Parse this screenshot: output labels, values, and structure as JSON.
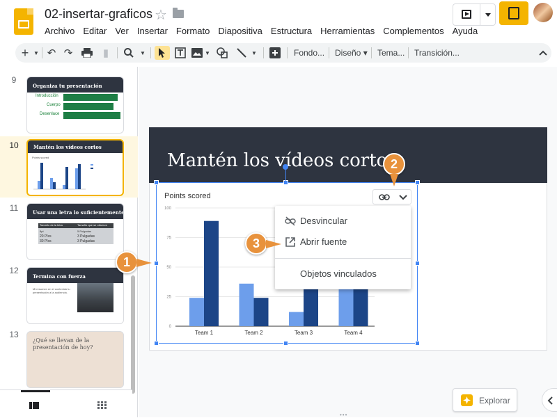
{
  "header": {
    "doc_title": "02-insertar-graficos",
    "menu": [
      "Archivo",
      "Editar",
      "Ver",
      "Insertar",
      "Formato",
      "Diapositiva",
      "Estructura",
      "Herramientas",
      "Complementos",
      "Ayuda"
    ]
  },
  "toolbar": {
    "fondo": "Fondo...",
    "diseno": "Diseño",
    "tema": "Tema...",
    "transicion": "Transición..."
  },
  "slides": [
    {
      "num": "9",
      "title": "Organiza tu presentación",
      "items": [
        "Introducción",
        "Cuerpo",
        "Desenlace"
      ]
    },
    {
      "num": "10",
      "title": "Mantén los vídeos cortos",
      "thumb_chart_title": "Points scored"
    },
    {
      "num": "11",
      "title": "Usar una letra lo suficientemente grande",
      "rows": [
        [
          "Tamaño de la letra",
          "Tamaño que se observa"
        ],
        [
          "8pt",
          "5 Pulgadas"
        ],
        [
          "20 Píxs",
          "3 Pulgadas"
        ],
        [
          "30 Píxs",
          "3 Pulgadas"
        ]
      ]
    },
    {
      "num": "12",
      "title": "Termina con fuerza",
      "body": "Mi resumen en el contenido tu presentación a la audiencia."
    },
    {
      "num": "13",
      "title": "¿Qué se llevan de la presentación de hoy?"
    }
  ],
  "slide": {
    "title": "Mantén los vídeos cortos"
  },
  "chart_data": {
    "type": "bar",
    "title": "Points scored",
    "categories": [
      "Team 1",
      "Team 2",
      "Team 3",
      "Team 4"
    ],
    "series": [
      {
        "name": "",
        "values": [
          24,
          36,
          12,
          82
        ],
        "color": "#6d9eeb"
      },
      {
        "name": "",
        "values": [
          89,
          24,
          84,
          90
        ],
        "color": "#1c4587"
      }
    ],
    "y_ticks": [
      "0",
      "25",
      "50",
      "75",
      "100"
    ],
    "ylim": [
      0,
      100
    ]
  },
  "dropdown": {
    "items": [
      "Desvincular",
      "Abrir fuente",
      "Objetos vinculados"
    ]
  },
  "badges": [
    "1",
    "2",
    "3"
  ],
  "footer": {
    "explorar": "Explorar"
  },
  "colors": {
    "accent": "#4285f4",
    "slides_yellow": "#f4b400",
    "badge_orange": "#e8923c",
    "slide_dark": "#2e3440"
  }
}
